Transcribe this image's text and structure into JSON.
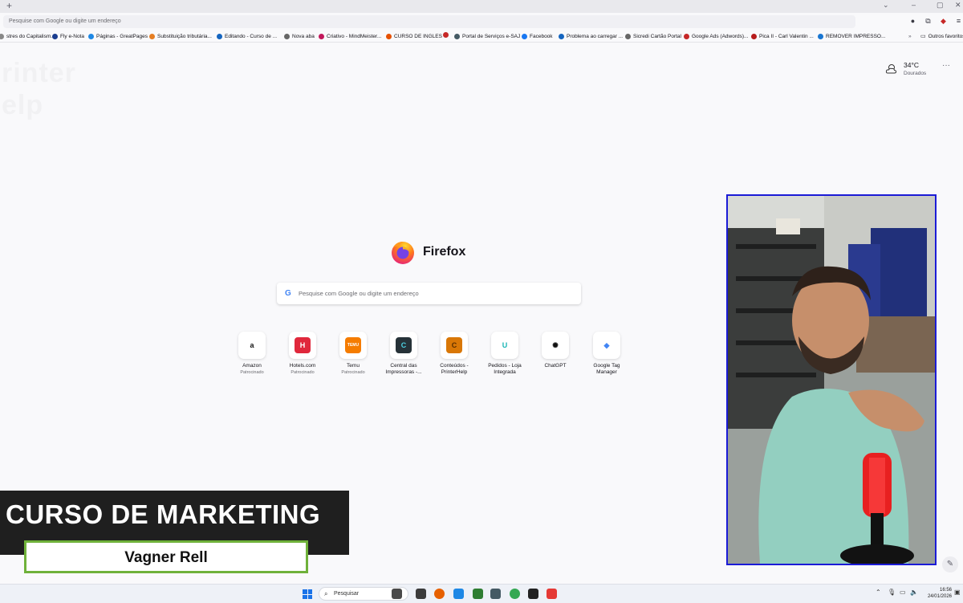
{
  "browser": {
    "new_tab_symbol": "+",
    "url_placeholder": "Pesquise com Google ou digite um endereço",
    "window_controls": [
      "⌄",
      "–",
      "▢",
      "✕"
    ]
  },
  "bookmarks": [
    {
      "label": "stres do Capitalism...",
      "color": "#888888"
    },
    {
      "label": "Fly e-Nota",
      "color": "#1a3d8f"
    },
    {
      "label": "Páginas - GreatPages",
      "color": "#1e88e5"
    },
    {
      "label": "Substituição tributária...",
      "color": "#e67e22"
    },
    {
      "label": "Editando - Curso de ...",
      "color": "#1565c0"
    },
    {
      "label": "Nova aba",
      "color": "#666666"
    },
    {
      "label": "Criativo - MindMeister...",
      "color": "#c2185b"
    },
    {
      "label": "CURSO DE INGLES",
      "color": "#e65100"
    },
    {
      "label": "",
      "color": "#c62828"
    },
    {
      "label": "Portal de Serviços e-SAJ",
      "color": "#455a64"
    },
    {
      "label": "Facebook",
      "color": "#1877f2"
    },
    {
      "label": "Problema ao carregar ...",
      "color": "#1565c0"
    },
    {
      "label": "Sicredi Cartão Portal",
      "color": "#666666"
    },
    {
      "label": "Google Ads (Adwords)...",
      "color": "#c62828"
    },
    {
      "label": "Pica II - Carl Valentin ...",
      "color": "#b71c1c"
    },
    {
      "label": "REMOVER IMPRESSO...",
      "color": "#1976d2"
    }
  ],
  "bookmarks_more": "»",
  "other_bookmarks": "Outros favoritos",
  "watermark": [
    "rinter",
    "elp"
  ],
  "weather": {
    "temp": "34°C",
    "city": "Dourados",
    "menu": "···"
  },
  "brand": "Firefox",
  "search": {
    "placeholder": "Pesquise com Google ou digite um endereço",
    "g": "G"
  },
  "top_sites": [
    {
      "name": "Amazon",
      "sub": "Patrocinado",
      "glyph": "a",
      "bg": "#ffffff",
      "fg": "#111111"
    },
    {
      "name": "Hotels.com",
      "sub": "Patrocinado",
      "glyph": "H",
      "bg": "#e0283c",
      "fg": "#ffffff"
    },
    {
      "name": "Temu",
      "sub": "Patrocinado",
      "glyph": "TEMU",
      "bg": "#f57c00",
      "fg": "#ffffff"
    },
    {
      "name": "Central das Impressoras -...",
      "sub": "",
      "glyph": "C",
      "bg": "#263238",
      "fg": "#4dd0e1"
    },
    {
      "name": "Conteúdos - PrinterHelp",
      "sub": "",
      "glyph": "C",
      "bg": "#d97706",
      "fg": "#5a2e00"
    },
    {
      "name": "Pedidos - Loja Integrada",
      "sub": "",
      "glyph": "U",
      "bg": "#ffffff",
      "fg": "#19b5b5"
    },
    {
      "name": "ChatGPT",
      "sub": "",
      "glyph": "✺",
      "bg": "#ffffff",
      "fg": "#111111"
    },
    {
      "name": "Google Tag Manager",
      "sub": "",
      "glyph": "◆",
      "bg": "#ffffff",
      "fg": "#4285f4"
    }
  ],
  "lower_third": {
    "title": "CURSO DE MARKETING",
    "name": "Vagner Rell"
  },
  "taskbar": {
    "search_label": "Pesquisar",
    "time": "16:56",
    "date": "24/01/2026",
    "apps": [
      "#4a4a4a",
      "#3b3b3b",
      "#e66000",
      "#1e88e5",
      "#2e7d32",
      "#455a64",
      "#34a853",
      "#222222",
      "#e53935"
    ]
  }
}
